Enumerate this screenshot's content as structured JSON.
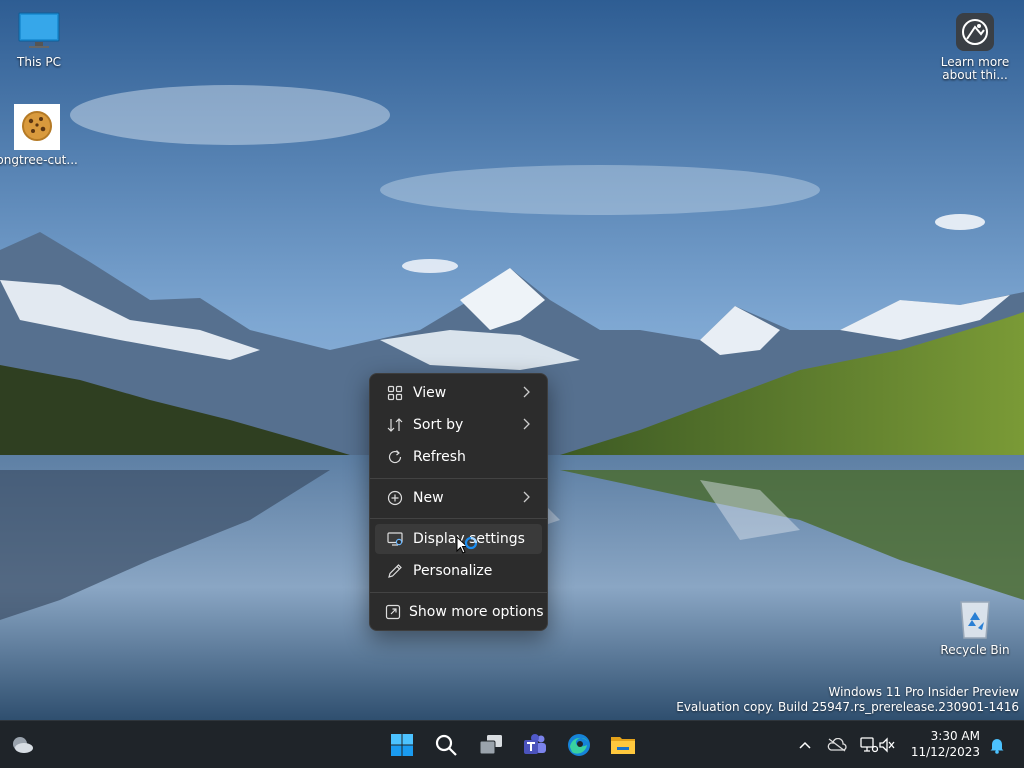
{
  "desktop": {
    "icons": [
      {
        "label": "This PC",
        "icon": "monitor-icon"
      },
      {
        "label": "pngtree-cut...",
        "icon": "cookie-icon"
      },
      {
        "label": "Learn more about thi...",
        "label_line1": "Learn more",
        "label_line2": "about thi...",
        "icon": "learn-more-icon"
      },
      {
        "label": "Recycle Bin",
        "icon": "recycle-bin-icon"
      }
    ]
  },
  "context_menu": {
    "items": [
      {
        "label": "View",
        "icon": "grid-icon",
        "submenu": true
      },
      {
        "label": "Sort by",
        "icon": "sort-icon",
        "submenu": true
      },
      {
        "label": "Refresh",
        "icon": "refresh-icon",
        "submenu": false
      },
      {
        "label": "New",
        "icon": "plus-circle-icon",
        "submenu": true
      },
      {
        "label": "Display settings",
        "icon": "display-settings-icon",
        "submenu": false,
        "hovered": true
      },
      {
        "label": "Personalize",
        "icon": "pen-icon",
        "submenu": false
      },
      {
        "label": "Show more options",
        "icon": "expand-icon",
        "submenu": false
      }
    ]
  },
  "watermark": {
    "line1": "Windows 11 Pro Insider Preview",
    "line2": "Evaluation copy. Build 25947.rs_prerelease.230901-1416"
  },
  "taskbar": {
    "pinned": [
      "windows-start-icon",
      "search-icon",
      "task-view-icon",
      "teams-icon",
      "edge-icon",
      "file-explorer-icon"
    ],
    "tray": [
      "chevron-up-icon",
      "onedrive-icon",
      "network-icon",
      "volume-muted-icon",
      "notification-bell-icon"
    ],
    "clock": {
      "time": "3:30 AM",
      "date": "11/12/2023"
    }
  },
  "colors": {
    "menu_bg": "#2c2c2c",
    "taskbar_bg": "#1f2429",
    "accent": "#0078d4"
  }
}
